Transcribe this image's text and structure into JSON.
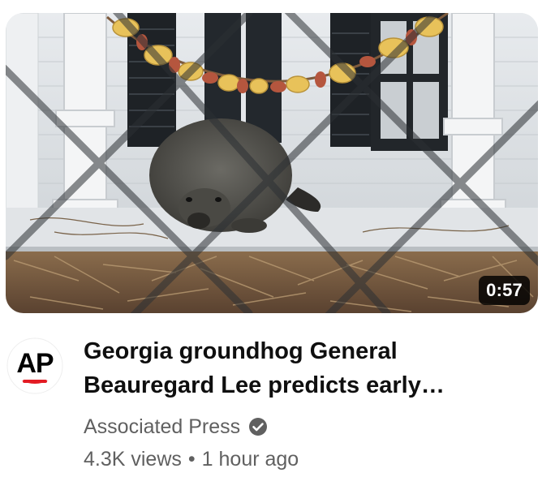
{
  "video": {
    "duration": "0:57",
    "title_line1": "Georgia groundhog General",
    "title_line2": "Beauregard Lee predicts early…",
    "channel_name": "Associated Press",
    "views": "4.3K views",
    "separator": "•",
    "age": "1 hour ago"
  },
  "avatar": {
    "logo_text": "AP",
    "logo_colors": {
      "text": "#000000",
      "accent": "#e31b23"
    }
  },
  "icons": {
    "verified": "verified-check-icon"
  },
  "colors": {
    "title": "#0f0f0f",
    "meta": "#606060",
    "duration_bg": "#000000",
    "duration_text": "#ffffff"
  }
}
